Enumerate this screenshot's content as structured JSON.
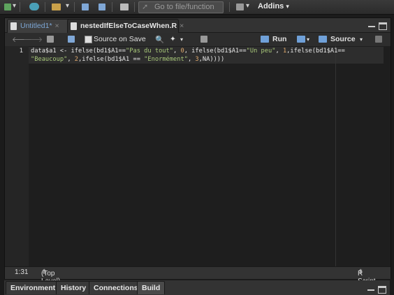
{
  "toolbar_top": {
    "goto_placeholder": "Go to file/function",
    "addins_label": "Addins",
    "dropdown_glyph": "▾"
  },
  "editor": {
    "tabs": [
      {
        "label": "Untitled1*",
        "close": "×"
      },
      {
        "label": "nestedIfElseToCaseWhen.R",
        "close": "×"
      }
    ],
    "source_on_save_label": "Source on Save",
    "run_label": "Run",
    "source_label": "Source",
    "line_number": "1",
    "code_lines": {
      "l1_a": "data$a1 <- ifelse(bd1$A1==",
      "l1_s1": "\"Pas du tout\"",
      "l1_b": ", ",
      "l1_n1": "0",
      "l1_c": ", ifelse(bd1$A1==",
      "l1_s2": "\"Un peu\"",
      "l1_d": ", ",
      "l1_n2": "1",
      "l1_e": ",ifelse(bd1$A1==",
      "l2_s1": "\"Beaucoup\"",
      "l2_a": ", ",
      "l2_n1": "2",
      "l2_b": ",ifelse(bd1$A1 == ",
      "l2_s2": "\"Enormément\"",
      "l2_c": ", ",
      "l2_n2": "3",
      "l2_d": ",NA))))"
    },
    "status": {
      "position": "1:31",
      "scope": "(Top Level)",
      "filetype": "R Script"
    }
  },
  "bottom_tabs": [
    "Environment",
    "History",
    "Connections",
    "Build"
  ]
}
